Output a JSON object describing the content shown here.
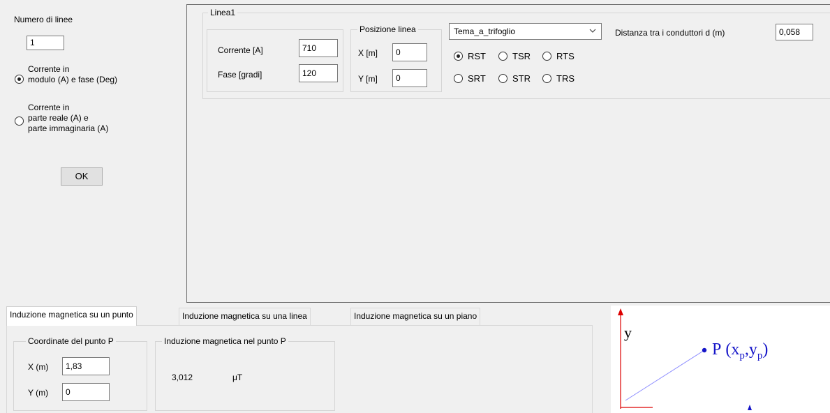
{
  "left": {
    "num_lines_label": "Numero di linee",
    "num_lines_value": "1",
    "radio_modulo_line1": "Corrente in",
    "radio_modulo_line2": "modulo (A) e fase (Deg)",
    "radio_reale_line1": "Corrente in",
    "radio_reale_line2": "parte reale (A) e",
    "radio_reale_line3": "parte immaginaria (A)",
    "ok_label": "OK"
  },
  "line1": {
    "group_title": "Linea1",
    "corrente_label": "Corrente [A]",
    "corrente_value": "710",
    "fase_label": "Fase [gradi]",
    "fase_value": "120",
    "posizione_title": "Posizione linea",
    "x_label": "X [m]",
    "x_value": "0",
    "y_label": "Y [m]",
    "y_value": "0",
    "config_selected": "Tema_a_trifoglio",
    "phases": [
      "RST",
      "TSR",
      "RTS",
      "SRT",
      "STR",
      "TRS"
    ],
    "phase_selected": "RST",
    "distanza_label": "Distanza tra i conduttori d (m)",
    "distanza_value": "0,058"
  },
  "tabs": [
    "Induzione magnetica su un punto",
    "Induzione magnetica su una linea",
    "Induzione magnetica su un piano"
  ],
  "punto": {
    "coord_title": "Coordinate del punto P",
    "x_label": "X (m)",
    "x_value": "1,83",
    "y_label": "Y (m)",
    "y_value": "0",
    "induzione_title": "Induzione magnetica nel punto P",
    "induzione_value": "3,012",
    "unit": "μT"
  },
  "diagram": {
    "y_axis": "y",
    "point_label": "P",
    "point_coord_x": "x",
    "point_coord_y": "y",
    "point_sub": "p",
    "point_color": "#1515c8"
  }
}
